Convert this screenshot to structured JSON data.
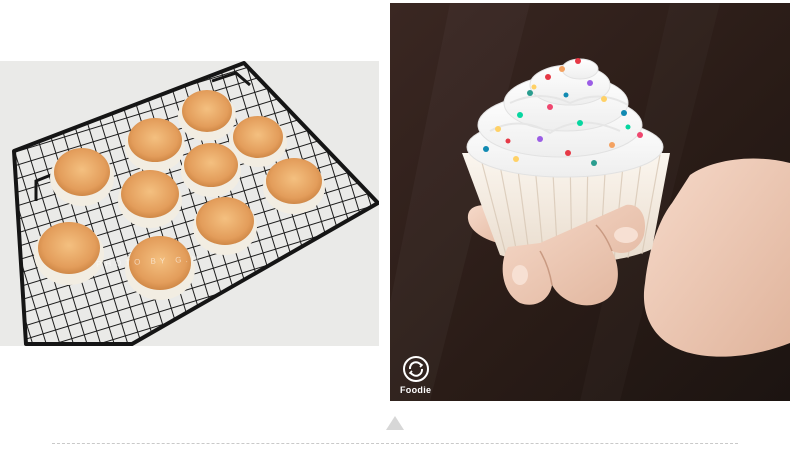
{
  "left_photo": {
    "subject": "nine baked cupcakes on a black wire cooling rack",
    "watermark_text": "PHOTO BY G.M"
  },
  "right_photo": {
    "subject": "hand holding a cupcake topped with whipped cream and rainbow sprinkles",
    "app_label": "Foodie"
  },
  "colors": {
    "background": "#ffffff",
    "cake_top": "#e8a869",
    "rack": "#1c1c1c",
    "right_bg": "#2b1d18",
    "divider": "#c9c9c9",
    "triangle": "#d7d7d7"
  }
}
